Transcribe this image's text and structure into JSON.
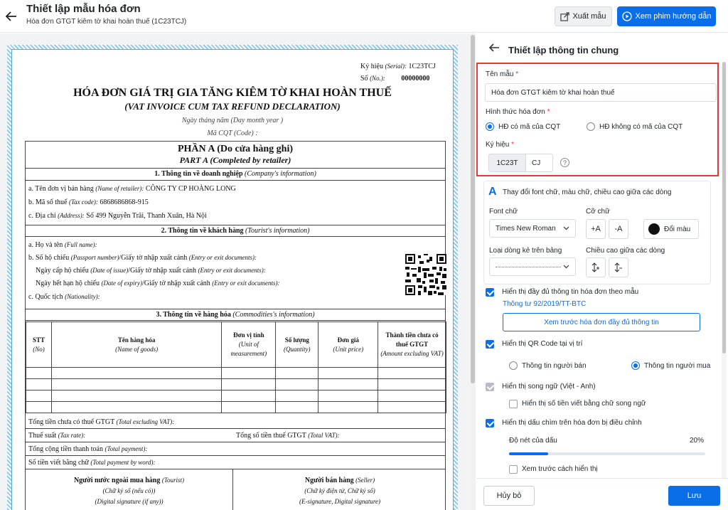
{
  "header": {
    "title": "Thiết lập mẫu hóa đơn",
    "subtitle": "Hóa đơn GTGT kiêm tờ khai hoàn thuế (1C23TCJ)",
    "export_label": "Xuất mẫu",
    "guide_label": "Xem phim hướng dẫn"
  },
  "invoice": {
    "serial_label": "Ký hiệu",
    "serial_en": "(Serial):",
    "serial_value": "1C23TCJ",
    "no_label": "Số",
    "no_en": "(No.):",
    "no_value": "00000000",
    "title_vn": "HÓA ĐƠN GIÁ TRỊ GIA TĂNG KIÊM TỜ KHAI HOÀN THUẾ",
    "title_en": "(VAT INVOICE CUM TAX REFUND DECLARATION)",
    "date_line": "Ngày   tháng   năm   (Day   month   year )",
    "cqt_line": "Mã CQT   (Code)  :",
    "part_a": "PHẦN A (Do cửa hàng ghi)",
    "part_a_en": "PART A (Completed by retailer)",
    "sec1": "1. Thông tin về doanh nghiệp",
    "sec1_en": "(Company's information)",
    "retailer_label": "a. Tên đơn vị bán hàng",
    "retailer_en": "(Name of retailer):",
    "retailer_value": "CÔNG TY CP HOÀNG LONG",
    "taxcode_label": "b. Mã số thuế",
    "taxcode_en": "(Tax code):",
    "taxcode_value": "6868686868-915",
    "address_label": "c. Địa chỉ",
    "address_en": "(Address):",
    "address_value": "Số 499 Nguyễn Trãi, Thanh Xuân, Hà Nội",
    "sec2": "2. Thông tin về khách hàng",
    "sec2_en": "(Tourist's information)",
    "name_label": "a. Họ và tên",
    "name_en": "(Full name):",
    "passport_label": "b. Số hộ chiếu",
    "passport_en": "(Passport number)",
    "passport_label2": "/Giấy tờ nhập xuất cảnh",
    "passport_en2": "(Entry or exit documents):",
    "issue_label": "Ngày cấp hộ chiếu",
    "issue_en": "(Date of issue)",
    "issue_label2": "/Giấy tờ nhập xuất cảnh",
    "issue_en2": "(Entry or exit documents):",
    "expiry_label": "Ngày hết hạn hộ chiếu",
    "expiry_en": "(Date of expiry)",
    "expiry_label2": "/Giấy tờ nhập xuất cảnh",
    "expiry_en2": "(Entry or exit documents):",
    "nationality_label": "c. Quốc tịch",
    "nationality_en": "(Nationality):",
    "sec3": "3. Thông tin về hàng hóa",
    "sec3_en": "(Commodities's information)",
    "col_stt": "STT",
    "col_stt_en": "(No)",
    "col_name": "Tên hàng hóa",
    "col_name_en": "(Name of goods)",
    "col_unit": "Đơn vị tính",
    "col_unit_en": "(Unit of measurement)",
    "col_qty": "Số lượng",
    "col_qty_en": "(Quantity)",
    "col_price": "Đơn giá",
    "col_price_en": "(Unit price)",
    "col_amount": "Thành tiền chưa có thuế GTGT",
    "col_amount_en": "(Amount excluding VAT)",
    "total_excl": "Tổng tiền chưa có thuế GTGT",
    "total_excl_en": "(Total excluding VAT):",
    "tax_rate": "Thuế suất",
    "tax_rate_en": "(Tax rate):",
    "tax_total": "Tổng số tiền thuế GTGT",
    "tax_total_en": "(Total VAT):",
    "total_pay": "Tổng cộng tiền thanh toán",
    "total_pay_en": "(Total payment):",
    "words": "Số tiền viết bằng chữ",
    "words_en": "(Total payment by word):",
    "buyer_title": "Người nước ngoài mua hàng",
    "buyer_en": "(Tourist)",
    "buyer_sign": "(Chữ ký số (nếu có))",
    "buyer_sign_en": "(Digital signature (if any))",
    "seller_title": "Người bán hàng",
    "seller_en": "(Seller)",
    "seller_sign": "(Chữ ký điện tử, Chữ ký số)",
    "seller_sign_en": "(E-signature, Digital signature)"
  },
  "panel": {
    "title": "Thiết lập thông tin chung",
    "template_name_label": "Tên mẫu",
    "template_name_value": "Hóa đơn GTGT kiêm tờ khai hoàn thuế",
    "form_label": "Hình thức hóa đơn",
    "form_opt1": "HĐ có mã của CQT",
    "form_opt2": "HĐ không có mã của CQT",
    "symbol_label": "Ký hiệu",
    "symbol_prefix": "1C23T",
    "symbol_value": "CJ",
    "help": "?",
    "required_mark": "*",
    "font_section_title": "Thay đổi font chữ, màu chữ, chiều cao giữa các dòng",
    "font_label": "Font chữ",
    "font_value": "Times New Roman",
    "size_label": "Cỡ chữ",
    "size_up": "+A",
    "size_down": "-A",
    "color_label": "Đổi màu",
    "line_type_label": "Loại dòng kẻ trên bảng",
    "line_height_label": "Chiều cao giữa các dòng",
    "show_full_label": "Hiển thị đầy đủ thông tin hóa đơn theo mẫu",
    "circular_link": "Thông tư 92/2019/TT-BTC",
    "preview_full_btn": "Xem trước hóa đơn đầy đủ thông tin",
    "show_qr_label": "Hiển thị QR Code tại vị trí",
    "qr_opt1": "Thông tin người bán",
    "qr_opt2": "Thông tin người mua",
    "bilingual_label": "Hiển thị song ngữ (Việt - Anh)",
    "bilingual_amount_label": "Hiển thị số tiền viết bằng chữ song ngữ",
    "watermark_label": "Hiển thị dấu chìm trên hóa đơn bị điều chỉnh",
    "sharpness_label": "Độ nét của dấu",
    "sharpness_value": "20%",
    "sharpness_fraction": 0.2,
    "preview_display_label": "Xem trước cách hiển thị",
    "cancel_label": "Hủy bỏ",
    "save_label": "Lưu"
  },
  "colors": {
    "accent": "#0a6ee8",
    "highlight_border": "#e53935"
  }
}
